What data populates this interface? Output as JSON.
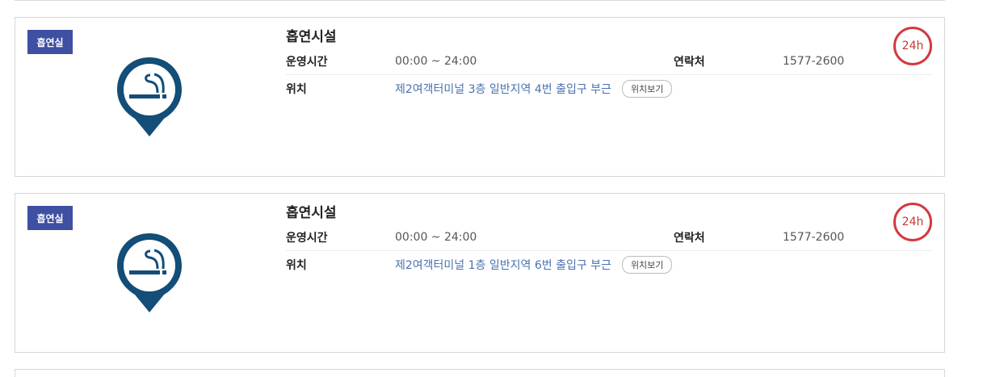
{
  "colors": {
    "badge": "#3f4fa2",
    "pin": "#134d78",
    "accent_24h": "#d2393f",
    "location_link": "#4a72b0"
  },
  "cards": [
    {
      "badge": "흡연실",
      "icon": "smoking-pin-icon",
      "title": "흡연시설",
      "hours_label": "운영시간",
      "hours_value": "00:00 ~ 24:00",
      "contact_label": "연락처",
      "contact_value": "1577-2600",
      "location_label": "위치",
      "location_value": "제2여객터미널 3층 일반지역 4번 출입구 부근",
      "location_button": "위치보기",
      "badge_24h": "24h"
    },
    {
      "badge": "흡연실",
      "icon": "smoking-pin-icon",
      "title": "흡연시설",
      "hours_label": "운영시간",
      "hours_value": "00:00 ~ 24:00",
      "contact_label": "연락처",
      "contact_value": "1577-2600",
      "location_label": "위치",
      "location_value": "제2여객터미널 1층 일반지역 6번 출입구 부근",
      "location_button": "위치보기",
      "badge_24h": "24h"
    }
  ]
}
